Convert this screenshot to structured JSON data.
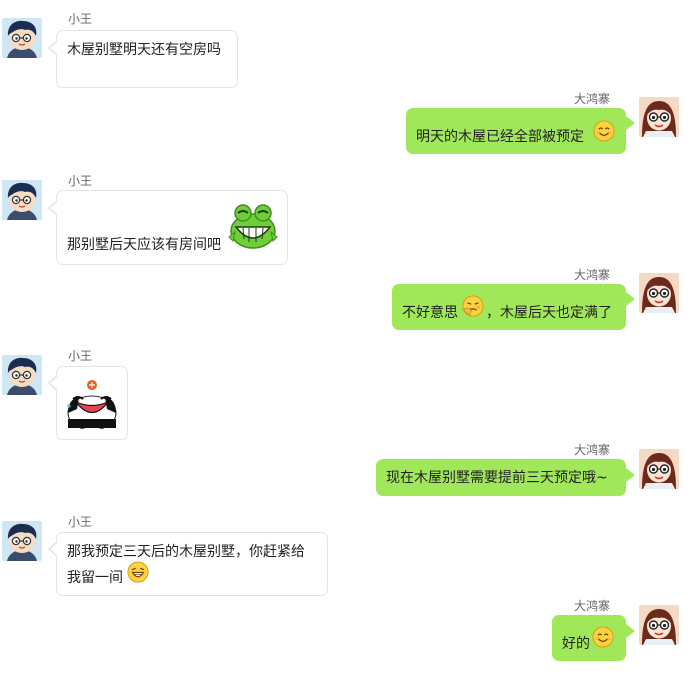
{
  "chat": {
    "contacts": {
      "left_name": "小王",
      "right_name": "大鸿寨"
    },
    "messages": [
      {
        "side": "left",
        "sender": "小王",
        "text": "木屋别墅明天还有空房吗"
      },
      {
        "side": "right",
        "sender": "大鸿寨",
        "text": "明天的木屋已经全部被预定",
        "emoji_after": "smile-emoji"
      },
      {
        "side": "left",
        "sender": "小王",
        "text": "那别墅后天应该有房间吧",
        "sticker": "frog-grin-sticker"
      },
      {
        "side": "right",
        "sender": "大鸿寨",
        "text_before": "不好意思",
        "emoji_mid": "embarrassed-emoji",
        "text_after": "，木屋后天也定满了"
      },
      {
        "side": "left",
        "sender": "小王",
        "sticker": "panda-crying-sticker"
      },
      {
        "side": "right",
        "sender": "大鸿寨",
        "text": "现在木屋别墅需要提前三天预定哦~"
      },
      {
        "side": "left",
        "sender": "小王",
        "text_line1": "那我预定三天后的木屋别墅，你赶紧给",
        "text_line2": "我留一间",
        "emoji_after": "laughing-emoji"
      },
      {
        "side": "right",
        "sender": "大鸿寨",
        "text": "好的",
        "emoji_after": "smile-emoji"
      }
    ]
  },
  "colors": {
    "outgoing_bubble": "#a0e75a",
    "incoming_bubble": "#ffffff",
    "incoming_border": "#e4e4e4",
    "name_text": "#666666"
  }
}
